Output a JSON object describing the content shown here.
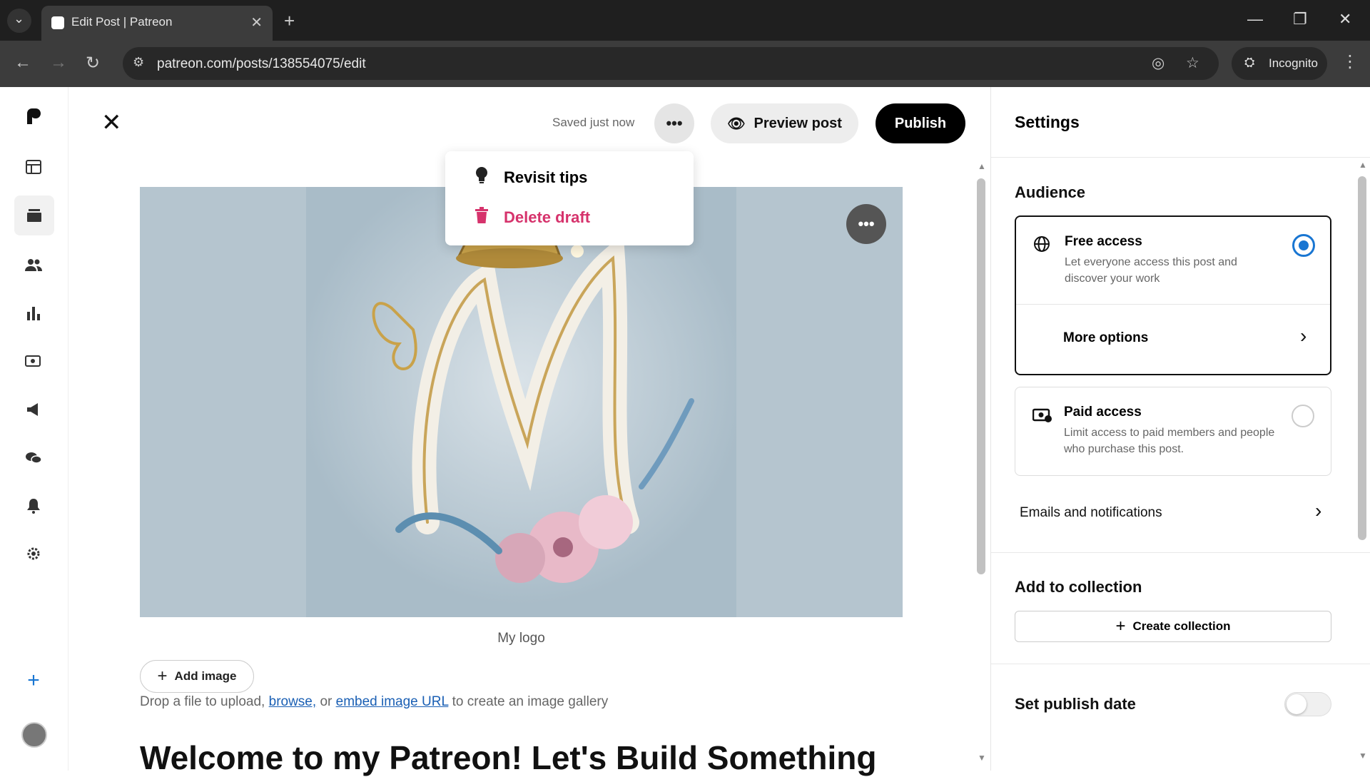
{
  "browser": {
    "tab_title": "Edit Post | Patreon",
    "url": "patreon.com/posts/138554075/edit",
    "profile_label": "Incognito"
  },
  "editor": {
    "saved_status": "Saved just now",
    "preview_label": "Preview post",
    "publish_label": "Publish",
    "menu": {
      "revisit_tips": "Revisit tips",
      "delete_draft": "Delete draft"
    },
    "image_caption": "My logo",
    "add_image_label": "Add image",
    "drop_hint": {
      "prefix": "Drop a file to upload,",
      "browse": "browse,",
      "or": "or",
      "embed": "embed image URL",
      "suffix": "to create an image gallery"
    },
    "post_title": "Welcome to my Patreon! Let's Build Something"
  },
  "settings": {
    "title": "Settings",
    "audience_title": "Audience",
    "free_access": {
      "title": "Free access",
      "description": "Let everyone access this post and discover your work",
      "selected": true
    },
    "more_options": "More options",
    "paid_access": {
      "title": "Paid access",
      "description": "Limit access to paid members and people who purchase this post.",
      "selected": false
    },
    "emails_notifications": "Emails and notifications",
    "collection_title": "Add to collection",
    "create_collection": "Create collection",
    "publish_date_title": "Set publish date",
    "publish_date_enabled": false
  },
  "colors": {
    "accent_blue": "#1976d2",
    "delete_red": "#d6336c",
    "publish_black": "#000000"
  }
}
